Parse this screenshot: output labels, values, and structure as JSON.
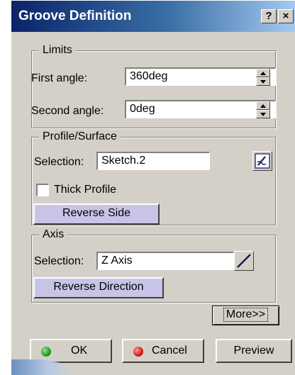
{
  "window": {
    "title": "Groove Definition",
    "help_label": "?",
    "close_label": "×"
  },
  "limits": {
    "legend": "Limits",
    "first_angle_label": "First angle:",
    "first_angle_value": "360deg",
    "second_angle_label": "Second angle:",
    "second_angle_value": "0deg"
  },
  "profile": {
    "legend": "Profile/Surface",
    "selection_label": "Selection:",
    "selection_value": "Sketch.2",
    "sketch_icon": "sketch-edit-icon",
    "thick_label": "Thick Profile",
    "thick_checked": false,
    "reverse_side_label": "Reverse Side"
  },
  "axis": {
    "legend": "Axis",
    "selection_label": "Selection:",
    "selection_value": "Z Axis",
    "axis_icon": "line-axis-icon",
    "reverse_direction_label": "Reverse Direction"
  },
  "more_label": "More>>",
  "buttons": {
    "ok_label": "OK",
    "cancel_label": "Cancel",
    "preview_label": "Preview"
  },
  "colors": {
    "ok_dot": "#1f9e2a",
    "cancel_dot": "#d11c1c",
    "title_bar": "#0a246a"
  }
}
